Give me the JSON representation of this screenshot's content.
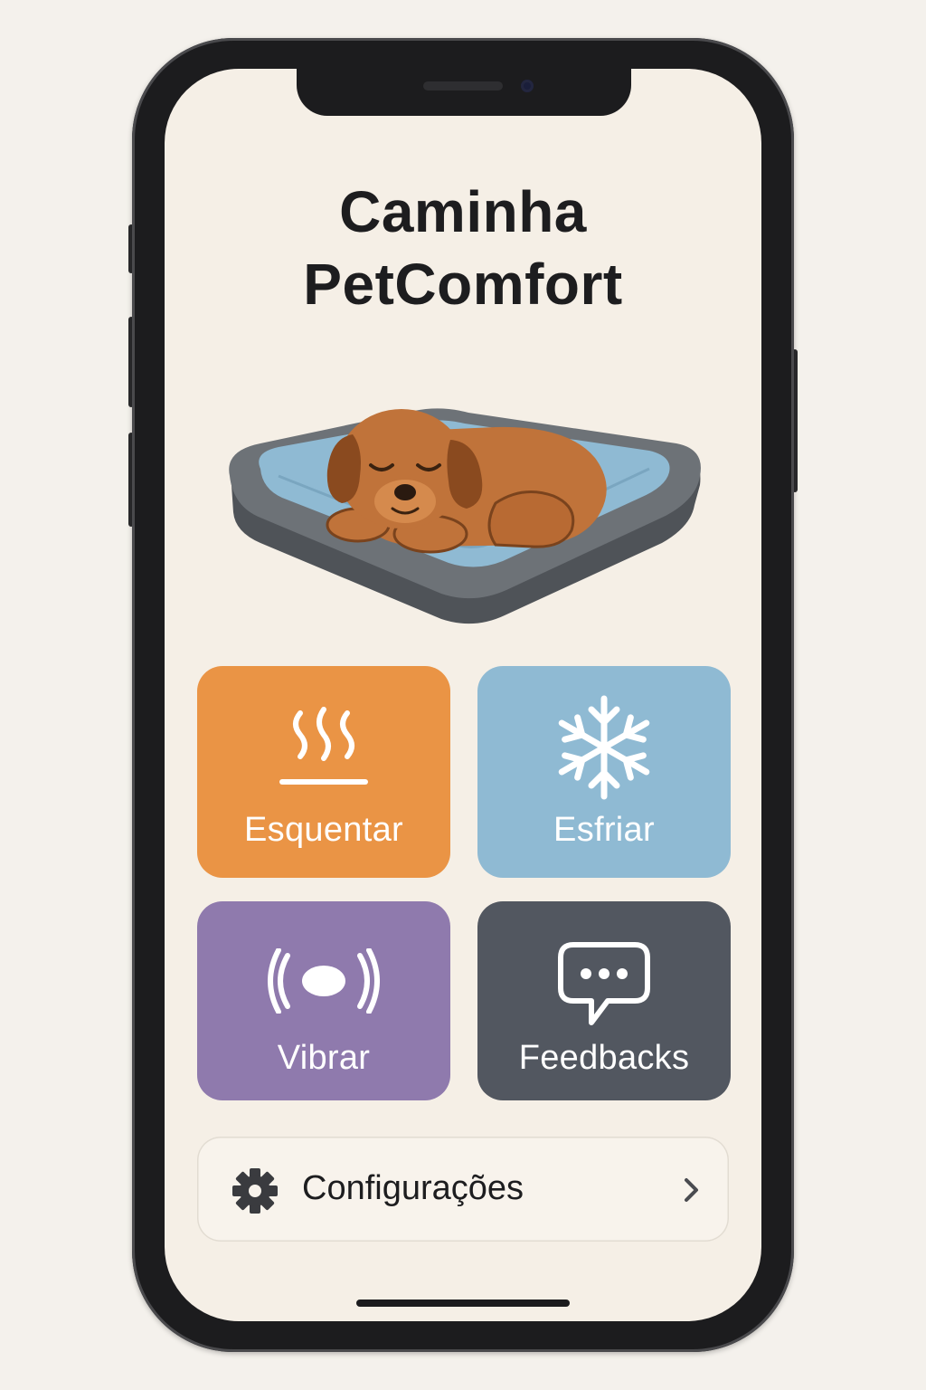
{
  "app": {
    "title_line1": "Caminha",
    "title_line2": "PetComfort"
  },
  "hero": {
    "illustration": "sleeping-dog-on-bed"
  },
  "actions": [
    {
      "id": "heat",
      "label": "Esquentar",
      "icon": "heat-waves-icon",
      "color": "#ea9445"
    },
    {
      "id": "cool",
      "label": "Esfriar",
      "icon": "snowflake-icon",
      "color": "#8fbad3"
    },
    {
      "id": "vibrate",
      "label": "Vibrar",
      "icon": "vibration-icon",
      "color": "#8f7aad"
    },
    {
      "id": "feedback",
      "label": "Feedbacks",
      "icon": "chat-bubble-icon",
      "color": "#525760"
    }
  ],
  "settings": {
    "label": "Configurações",
    "icon": "gear-icon",
    "chevron": "chevron-right-icon"
  }
}
